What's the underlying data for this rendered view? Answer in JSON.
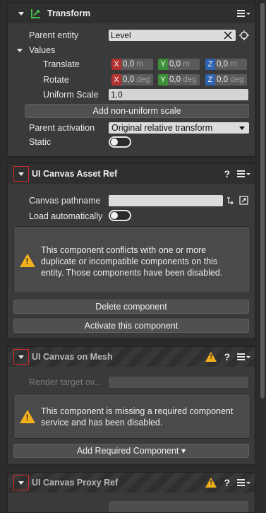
{
  "transform": {
    "title": "Transform",
    "parent_entity_label": "Parent entity",
    "parent_entity_value": "Level",
    "values_label": "Values",
    "translate_label": "Translate",
    "rotate_label": "Rotate",
    "uniform_scale_label": "Uniform Scale",
    "uniform_scale_value": "1,0",
    "translate": {
      "x": "0,0",
      "y": "0,0",
      "z": "0,0",
      "unit": "m"
    },
    "rotate": {
      "x": "0,0",
      "y": "0,0",
      "z": "0,0",
      "unit": "deg"
    },
    "axis_labels": {
      "x": "X",
      "y": "Y",
      "z": "Z"
    },
    "add_nonuniform_label": "Add non-uniform scale",
    "parent_activation_label": "Parent activation",
    "parent_activation_value": "Original relative transform",
    "static_label": "Static"
  },
  "ui_canvas_asset_ref": {
    "title": "UI Canvas Asset Ref",
    "help": "?",
    "canvas_pathname_label": "Canvas pathname",
    "canvas_pathname_value": "",
    "load_auto_label": "Load automatically",
    "warning_text": "This component conflicts with one or more duplicate or incompatible components on this entity. Those components have been disabled.",
    "delete_label": "Delete component",
    "activate_label": "Activate this component"
  },
  "ui_canvas_on_mesh": {
    "title": "UI Canvas on Mesh",
    "help": "?",
    "render_target_label": "Render target ov...",
    "warning_text": "This component is missing a required component service and has been disabled.",
    "add_required_label": "Add Required Component ▾"
  },
  "ui_canvas_proxy_ref": {
    "title": "UI Canvas Proxy Ref",
    "help": "?"
  },
  "colors": {
    "axis_x": "#b3312f",
    "axis_y": "#3f8f3a",
    "axis_z": "#2f62b0",
    "warning": "#f3b21a",
    "highlight_outline": "#d22b2b"
  }
}
